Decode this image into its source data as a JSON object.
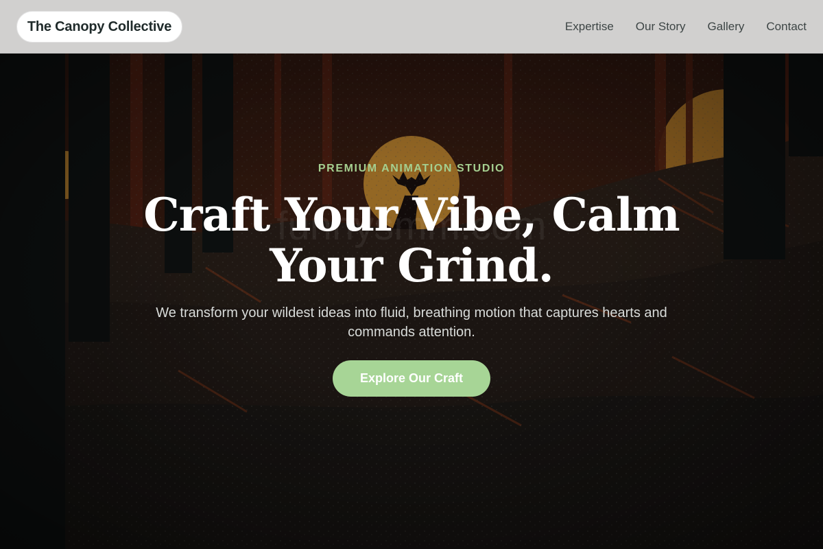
{
  "navbar": {
    "logo": "The Canopy Collective",
    "links": [
      "Expertise",
      "Our Story",
      "Gallery",
      "Contact"
    ]
  },
  "hero": {
    "eyebrow": "PREMIUM ANIMATION STUDIO",
    "headline": "Craft Your Vibe, Calm Your Grind.",
    "subtext": "We transform your wildest ideas into fluid, breathing motion that captures hearts and commands attention.",
    "cta": "Explore Our Craft",
    "watermark": "funnysmm.com"
  },
  "colors": {
    "accent": "#a7d596",
    "eyebrow": "#a5cf90",
    "navbar_bg": "#d6d6d6",
    "sun": "#e8a23a"
  },
  "icons": {
    "deer": "deer-silhouette-icon"
  }
}
